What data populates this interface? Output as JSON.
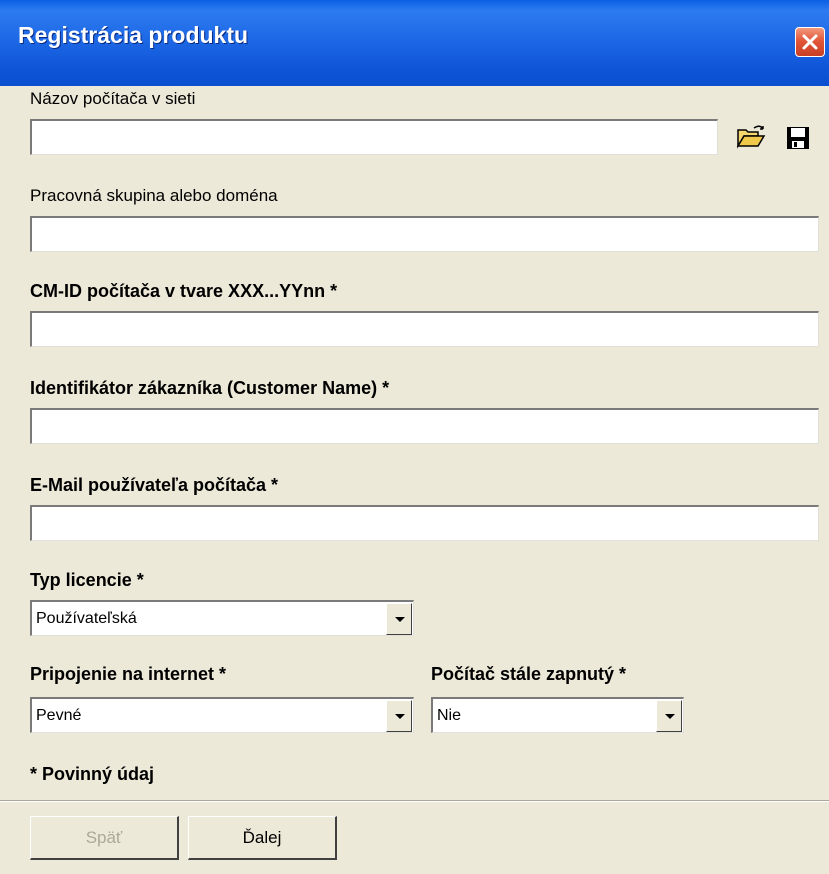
{
  "window": {
    "title": "Registrácia produktu"
  },
  "fields": {
    "computer_name": {
      "label": "Názov počítača v sieti",
      "value": ""
    },
    "workgroup": {
      "label": "Pracovná skupina alebo doména",
      "value": ""
    },
    "cmid": {
      "label": "CM-ID počítača v tvare XXX...YYnn *",
      "value": ""
    },
    "customer": {
      "label": "Identifikátor zákazníka (Customer Name) *",
      "value": ""
    },
    "email": {
      "label": "E-Mail používateľa počítača *",
      "value": ""
    },
    "license": {
      "label": "Typ licencie *",
      "selected": "Používateľská"
    },
    "internet": {
      "label": "Pripojenie na internet *",
      "selected": "Pevné"
    },
    "always_on": {
      "label": "Počítač stále zapnutý *",
      "selected": "Nie"
    }
  },
  "required_note": "* Povinný údaj",
  "buttons": {
    "back": "Späť",
    "next": "Ďalej"
  },
  "icons": {
    "open": "open-folder-icon",
    "save": "save-disk-icon",
    "close": "close-icon"
  },
  "colors": {
    "titlebar": "#0A5FE3",
    "background": "#ECE9D8",
    "close": "#E2573A"
  }
}
